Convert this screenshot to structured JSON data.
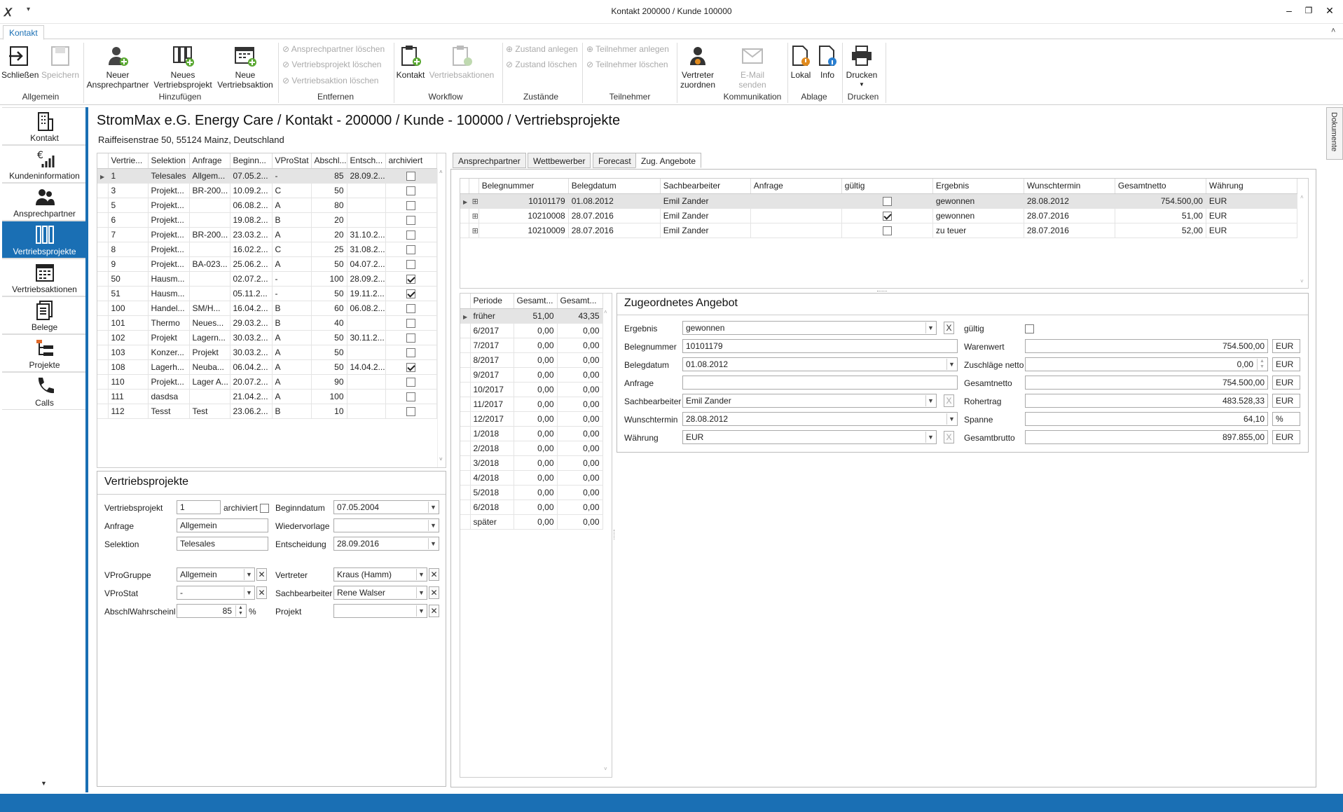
{
  "window": {
    "title": "Kontakt 200000 / Kunde 100000"
  },
  "ribbon": {
    "tab": "Kontakt",
    "buttons": {
      "schliessen": "Schließen",
      "speichern": "Speichern",
      "neuer_ap_1": "Neuer",
      "neuer_ap_2": "Ansprechpartner",
      "neues_vp_1": "Neues",
      "neues_vp_2": "Vertriebsprojekt",
      "neue_va_1": "Neue",
      "neue_va_2": "Vertriebsaktion",
      "kontakt": "Kontakt",
      "vertriebsaktionen": "Vertriebsaktionen",
      "vertreter_1": "Vertreter",
      "vertreter_2": "zuordnen",
      "email_1": "E-Mail",
      "email_2": "senden",
      "lokal": "Lokal",
      "info": "Info",
      "drucken": "Drucken"
    },
    "small": {
      "ap_loeschen": "Ansprechpartner löschen",
      "vp_loeschen": "Vertriebsprojekt löschen",
      "va_loeschen": "Vertriebsaktion löschen",
      "zustand_anlegen": "Zustand anlegen",
      "zustand_loeschen": "Zustand löschen",
      "tn_anlegen": "Teilnehmer anlegen",
      "tn_loeschen": "Teilnehmer löschen"
    },
    "groups": {
      "allgemein": "Allgemein",
      "hinzufuegen": "Hinzufügen",
      "entfernen": "Entfernen",
      "workflow": "Workflow",
      "zustaende": "Zustände",
      "teilnehmer": "Teilnehmer",
      "kommunikation": "Kommunikation",
      "ablage": "Ablage",
      "drucken": "Drucken"
    }
  },
  "nav": [
    "Kontakt",
    "Kundeninformation",
    "Ansprechpartner",
    "Vertriebsprojekte",
    "Vertriebsaktionen",
    "Belege",
    "Projekte",
    "Calls"
  ],
  "header": {
    "title": "StromMax e.G. Energy Care / Kontakt - 200000 / Kunde - 100000 / Vertriebsprojekte",
    "address": "Raiffeisenstrae 50, 55124 Mainz, Deutschland"
  },
  "projects": {
    "columns": [
      "Vertrie...",
      "Selektion",
      "Anfrage",
      "Beginn...",
      "VProStat",
      "Abschl...",
      "Entsch...",
      "archiviert"
    ],
    "rows": [
      {
        "nr": "1",
        "sel": "Telesales",
        "anf": "Allgem...",
        "beg": "07.05.2...",
        "stat": "-",
        "abs": "85",
        "ent": "28.09.2...",
        "arch": false
      },
      {
        "nr": "3",
        "sel": "Projekt...",
        "anf": "BR-200...",
        "beg": "10.09.2...",
        "stat": "C",
        "abs": "50",
        "ent": "",
        "arch": false
      },
      {
        "nr": "5",
        "sel": "Projekt...",
        "anf": "",
        "beg": "06.08.2...",
        "stat": "A",
        "abs": "80",
        "ent": "",
        "arch": false
      },
      {
        "nr": "6",
        "sel": "Projekt...",
        "anf": "",
        "beg": "19.08.2...",
        "stat": "B",
        "abs": "20",
        "ent": "",
        "arch": false
      },
      {
        "nr": "7",
        "sel": "Projekt...",
        "anf": "BR-200...",
        "beg": "23.03.2...",
        "stat": "A",
        "abs": "20",
        "ent": "31.10.2...",
        "arch": false
      },
      {
        "nr": "8",
        "sel": "Projekt...",
        "anf": "",
        "beg": "16.02.2...",
        "stat": "C",
        "abs": "25",
        "ent": "31.08.2...",
        "arch": false
      },
      {
        "nr": "9",
        "sel": "Projekt...",
        "anf": "BA-023...",
        "beg": "25.06.2...",
        "stat": "A",
        "abs": "50",
        "ent": "04.07.2...",
        "arch": false
      },
      {
        "nr": "50",
        "sel": "Hausm...",
        "anf": "",
        "beg": "02.07.2...",
        "stat": "-",
        "abs": "100",
        "ent": "28.09.2...",
        "arch": true
      },
      {
        "nr": "51",
        "sel": "Hausm...",
        "anf": "",
        "beg": "05.11.2...",
        "stat": "-",
        "abs": "50",
        "ent": "19.11.2...",
        "arch": true
      },
      {
        "nr": "100",
        "sel": "Handel...",
        "anf": "SM/H...",
        "beg": "16.04.2...",
        "stat": "B",
        "abs": "60",
        "ent": "06.08.2...",
        "arch": false
      },
      {
        "nr": "101",
        "sel": "Thermo",
        "anf": "Neues...",
        "beg": "29.03.2...",
        "stat": "B",
        "abs": "40",
        "ent": "",
        "arch": false
      },
      {
        "nr": "102",
        "sel": "Projekt",
        "anf": "Lagern...",
        "beg": "30.03.2...",
        "stat": "A",
        "abs": "50",
        "ent": "30.11.2...",
        "arch": false
      },
      {
        "nr": "103",
        "sel": "Konzer...",
        "anf": "Projekt",
        "beg": "30.03.2...",
        "stat": "A",
        "abs": "50",
        "ent": "",
        "arch": false
      },
      {
        "nr": "108",
        "sel": "Lagerh...",
        "anf": "Neuba...",
        "beg": "06.04.2...",
        "stat": "A",
        "abs": "50",
        "ent": "14.04.2...",
        "arch": true
      },
      {
        "nr": "110",
        "sel": "Projekt...",
        "anf": "Lager A...",
        "beg": "20.07.2...",
        "stat": "A",
        "abs": "90",
        "ent": "",
        "arch": false
      },
      {
        "nr": "111",
        "sel": "dasdsa",
        "anf": "",
        "beg": "21.04.2...",
        "stat": "A",
        "abs": "100",
        "ent": "",
        "arch": false
      },
      {
        "nr": "112",
        "sel": "Tesst",
        "anf": "Test",
        "beg": "23.06.2...",
        "stat": "B",
        "abs": "10",
        "ent": "",
        "arch": false
      }
    ]
  },
  "vp_form": {
    "title": "Vertriebsprojekte",
    "labels": {
      "vertriebsprojekt": "Vertriebsprojekt",
      "archiviert": "archiviert",
      "beginndatum": "Beginndatum",
      "anfrage": "Anfrage",
      "wiedervorlage": "Wiedervorlage",
      "selektion": "Selektion",
      "entscheidung": "Entscheidung",
      "vprogruppe": "VProGruppe",
      "vertreter": "Vertreter",
      "vprostat": "VProStat",
      "sachbearbeiter": "Sachbearbeiter",
      "abschl": "AbschlWahrscheinl",
      "projekt": "Projekt",
      "pct": "%"
    },
    "values": {
      "vertriebsprojekt": "1",
      "beginndatum": "07.05.2004",
      "anfrage": "Allgemein",
      "wiedervorlage": "",
      "selektion": "Telesales",
      "entscheidung": "28.09.2016",
      "vprogruppe": "Allgemein",
      "vertreter": "Kraus (Hamm)",
      "vprostat": "-",
      "sachbearbeiter": "Rene Walser",
      "abschl": "85",
      "projekt": ""
    }
  },
  "right_tabs": [
    "Ansprechpartner",
    "Wettbewerber",
    "Forecast",
    "Zug. Angebote"
  ],
  "offers": {
    "columns": [
      "Belegnummer",
      "Belegdatum",
      "Sachbearbeiter",
      "Anfrage",
      "gültig",
      "Ergebnis",
      "Wunschtermin",
      "Gesamtnetto",
      "Währung"
    ],
    "rows": [
      {
        "nr": "10101179",
        "datum": "01.08.2012",
        "sb": "Emil Zander",
        "anf": "",
        "gueltig": false,
        "erg": "gewonnen",
        "wunsch": "28.08.2012",
        "netto": "754.500,00",
        "wae": "EUR"
      },
      {
        "nr": "10210008",
        "datum": "28.07.2016",
        "sb": "Emil Zander",
        "anf": "",
        "gueltig": true,
        "erg": "gewonnen",
        "wunsch": "28.07.2016",
        "netto": "51,00",
        "wae": "EUR"
      },
      {
        "nr": "10210009",
        "datum": "28.07.2016",
        "sb": "Emil Zander",
        "anf": "",
        "gueltig": false,
        "erg": "zu teuer",
        "wunsch": "28.07.2016",
        "netto": "52,00",
        "wae": "EUR"
      }
    ]
  },
  "periods": {
    "columns": [
      "Periode",
      "Gesamt...",
      "Gesamt..."
    ],
    "rows": [
      [
        "früher",
        "51,00",
        "43,35"
      ],
      [
        "6/2017",
        "0,00",
        "0,00"
      ],
      [
        "7/2017",
        "0,00",
        "0,00"
      ],
      [
        "8/2017",
        "0,00",
        "0,00"
      ],
      [
        "9/2017",
        "0,00",
        "0,00"
      ],
      [
        "10/2017",
        "0,00",
        "0,00"
      ],
      [
        "11/2017",
        "0,00",
        "0,00"
      ],
      [
        "12/2017",
        "0,00",
        "0,00"
      ],
      [
        "1/2018",
        "0,00",
        "0,00"
      ],
      [
        "2/2018",
        "0,00",
        "0,00"
      ],
      [
        "3/2018",
        "0,00",
        "0,00"
      ],
      [
        "4/2018",
        "0,00",
        "0,00"
      ],
      [
        "5/2018",
        "0,00",
        "0,00"
      ],
      [
        "6/2018",
        "0,00",
        "0,00"
      ],
      [
        "später",
        "0,00",
        "0,00"
      ]
    ]
  },
  "offer_form": {
    "title": "Zugeordnetes Angebot",
    "labels": {
      "ergebnis": "Ergebnis",
      "gueltig": "gültig",
      "belegnummer": "Belegnummer",
      "warenwert": "Warenwert",
      "belegdatum": "Belegdatum",
      "zuschlaege": "Zuschläge netto",
      "anfrage": "Anfrage",
      "gesamtnetto": "Gesamtnetto",
      "sachbearbeiter": "Sachbearbeiter",
      "rohertrag": "Rohertrag",
      "wunschtermin": "Wunschtermin",
      "spanne": "Spanne",
      "waehrung": "Währung",
      "gesamtbrutto": "Gesamtbrutto"
    },
    "values": {
      "ergebnis": "gewonnen",
      "belegnummer": "10101179",
      "belegdatum": "01.08.2012",
      "anfrage": "",
      "sachbearbeiter": "Emil Zander",
      "wunschtermin": "28.08.2012",
      "waehrung": "EUR",
      "warenwert": "754.500,00",
      "zuschlaege": "0,00",
      "gesamtnetto": "754.500,00",
      "rohertrag": "483.528,33",
      "spanne": "64,10",
      "gesamtbrutto": "897.855,00",
      "eur": "EUR",
      "pct": "%"
    }
  },
  "side": {
    "dokumente": "Dokumente"
  },
  "colors": {
    "accent": "#1a6fb4",
    "selection": "#e4e4e4"
  }
}
